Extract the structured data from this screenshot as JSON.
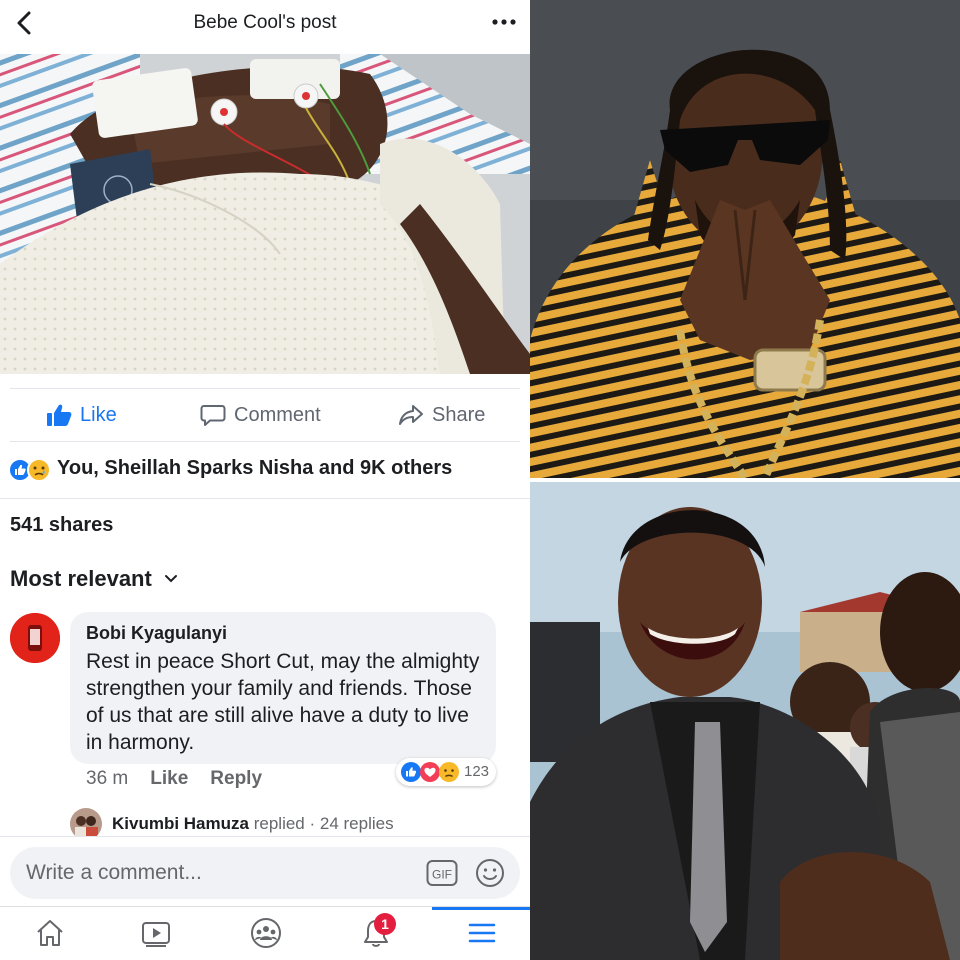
{
  "header": {
    "title": "Bebe Cool's post",
    "back_icon": "chevron-left-icon",
    "more_icon": "more-horizontal-icon"
  },
  "post": {
    "photo_desc_icon": "hospital-photo",
    "actions": {
      "like": "Like",
      "comment": "Comment",
      "share": "Share"
    },
    "reactions_text": "You, Sheillah Sparks Nisha and 9K others",
    "shares_text": "541 shares",
    "sort_label": "Most relevant"
  },
  "comment": {
    "author": "Bobi Kyagulanyi",
    "text": "Rest in peace Short Cut, may the almighty strengthen your family and friends. Those of us that are still alive have a duty to live in harmony.",
    "time": "36 m",
    "like_label": "Like",
    "reply_label": "Reply",
    "reaction_count": "123",
    "reply_author": "Kivumbi Hamuza",
    "reply_action": "replied",
    "reply_count": "· 24 replies"
  },
  "composer": {
    "placeholder": "Write a comment...",
    "gif_label": "GIF"
  },
  "nav": {
    "notification_badge": "1",
    "active": "menu"
  },
  "colors": {
    "accent": "#1877f2",
    "badge": "#e41e3f",
    "bubble": "#f0f2f5"
  }
}
